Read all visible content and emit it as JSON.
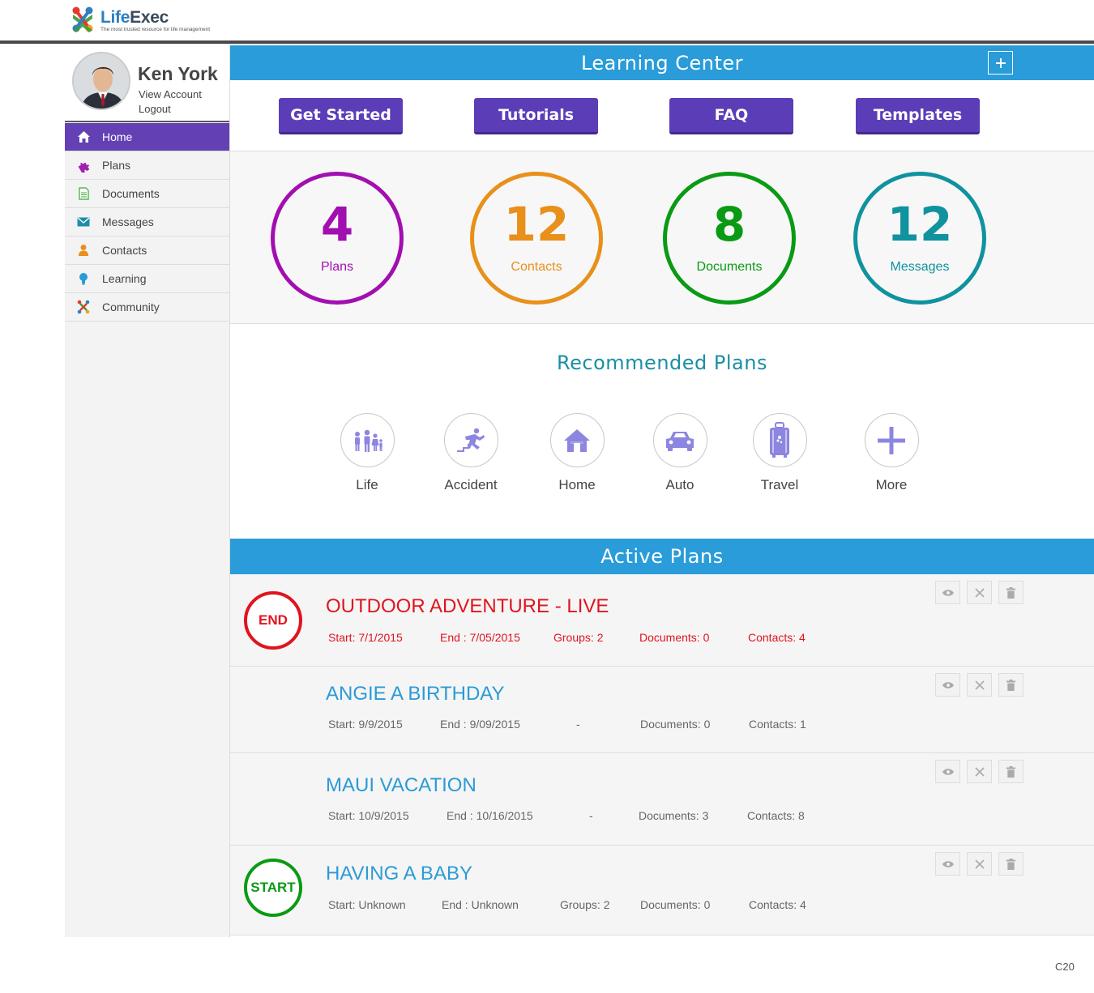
{
  "logo": {
    "name_first": "Life",
    "name_second": "Exec",
    "tagline": "The most trusted resource for life management"
  },
  "user": {
    "name": "Ken York",
    "view_account": "View Account",
    "logout": "Logout"
  },
  "nav": [
    {
      "label": "Home",
      "icon": "home-icon",
      "active": true
    },
    {
      "label": "Plans",
      "icon": "puzzle-icon"
    },
    {
      "label": "Documents",
      "icon": "document-icon"
    },
    {
      "label": "Messages",
      "icon": "envelope-icon"
    },
    {
      "label": "Contacts",
      "icon": "person-icon"
    },
    {
      "label": "Learning",
      "icon": "lightbulb-icon"
    },
    {
      "label": "Community",
      "icon": "community-icon"
    }
  ],
  "learning_center": {
    "title": "Learning Center",
    "buttons": [
      "Get Started",
      "Tutorials",
      "FAQ",
      "Templates"
    ]
  },
  "stats": [
    {
      "value": "4",
      "label": "Plans",
      "color": "#a20fb0"
    },
    {
      "value": "12",
      "label": "Contacts",
      "color": "#e8901a"
    },
    {
      "value": "8",
      "label": "Documents",
      "color": "#0a9a14"
    },
    {
      "value": "12",
      "label": "Messages",
      "color": "#10929f"
    }
  ],
  "recommended": {
    "title": "Recommended Plans",
    "items": [
      {
        "label": "Life",
        "icon": "family-icon"
      },
      {
        "label": "Accident",
        "icon": "falling-person-icon"
      },
      {
        "label": "Home",
        "icon": "house-icon"
      },
      {
        "label": "Auto",
        "icon": "car-icon"
      },
      {
        "label": "Travel",
        "icon": "suitcase-icon"
      },
      {
        "label": "More",
        "icon": "plus-icon"
      }
    ]
  },
  "active_plans": {
    "title": "Active Plans",
    "plans": [
      {
        "badge": "END",
        "badge_color": "#e0141e",
        "title": "OUTDOOR ADVENTURE - LIVE",
        "title_color": "#e0141e",
        "start": "Start:  7/1/2015",
        "end": "End : 7/05/2015",
        "groups": "Groups:  2",
        "documents": "Documents:   0",
        "contacts": "Contacts:   4",
        "meta_color": "#e0141e"
      },
      {
        "badge": "",
        "title": "ANGIE A BIRTHDAY",
        "title_color": "#2a9bd6",
        "start": "Start:  9/9/2015",
        "end": "End : 9/09/2015",
        "groups": "-",
        "documents": "Documents:   0",
        "contacts": "Contacts:   1",
        "meta_color": "#666666"
      },
      {
        "badge": "",
        "title": "MAUI VACATION",
        "title_color": "#2a9bd6",
        "start": "Start:  10/9/2015",
        "end": "End : 10/16/2015",
        "groups": "-",
        "documents": "Documents:   3",
        "contacts": "Contacts:  8",
        "meta_color": "#666666"
      },
      {
        "badge": "START",
        "badge_color": "#0a9a14",
        "title": "HAVING A BABY",
        "title_color": "#2a9bd6",
        "start": "Start:  Unknown",
        "end": "End : Unknown",
        "groups": "Groups:  2",
        "documents": "Documents:   0",
        "contacts": "Contacts:  4",
        "meta_color": "#666666"
      }
    ]
  },
  "footer_code": "C20"
}
